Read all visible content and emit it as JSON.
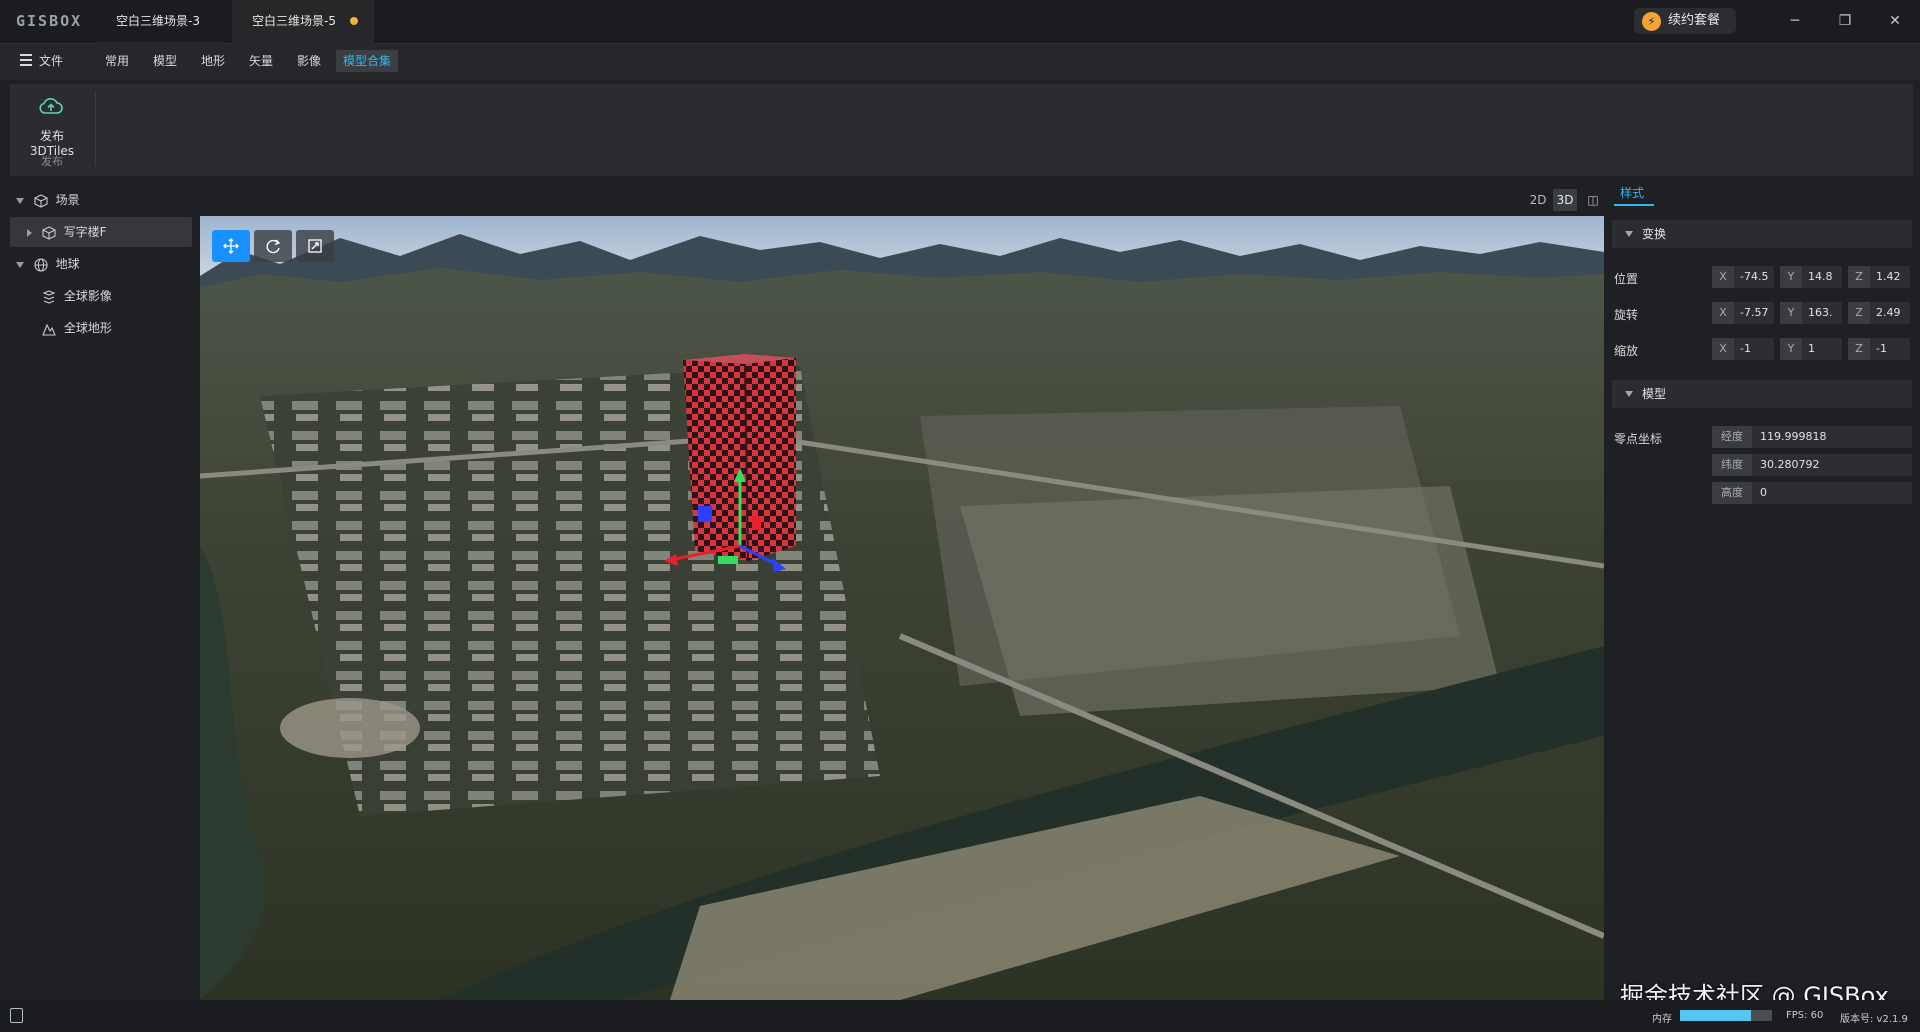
{
  "app": {
    "logo": "GISBOX"
  },
  "tabs": [
    {
      "label": "空白三维场景-3"
    },
    {
      "label": "空白三维场景-5",
      "unsaved": true
    }
  ],
  "renew_button": {
    "label": "续约套餐",
    "icon": "lightning-icon"
  },
  "window_controls": {
    "minimize": "─",
    "restore": "❐",
    "close": "✕"
  },
  "menu": {
    "file": "文件",
    "items": [
      "常用",
      "模型",
      "地形",
      "矢量",
      "影像",
      "模型合集"
    ],
    "active": "模型合集"
  },
  "ribbon": {
    "publish_label": "发布3DTiles",
    "group_label": "发布",
    "icon": "cloud-upload-icon"
  },
  "tree": {
    "scene": "场景",
    "scene_child": "写字楼F",
    "earth": "地球",
    "imagery": "全球影像",
    "terrain": "全球地形"
  },
  "view_modes": {
    "two_d": "2D",
    "three_d": "3D",
    "split": "◫",
    "active": "3D"
  },
  "viewport_tools": [
    "move-tool-icon",
    "rotate-tool-icon",
    "scale-tool-icon"
  ],
  "right_panel": {
    "tab": "样式",
    "transform": {
      "title": "变换",
      "position_label": "位置",
      "rotation_label": "旋转",
      "scale_label": "缩放",
      "position": {
        "x": "-74.5",
        "y": "14.8",
        "z": "1.42"
      },
      "rotation": {
        "x": "-7.57",
        "y": "163.",
        "z": "2.49"
      },
      "scale": {
        "x": "-1",
        "y": "1",
        "z": "-1"
      }
    },
    "model": {
      "title": "模型",
      "origin_label": "零点坐标",
      "lon_label": "经度",
      "lon": "119.999818",
      "lat_label": "纬度",
      "lat": "30.280792",
      "height_label": "高度",
      "height": "0"
    }
  },
  "watermark": "掘金技术社区 @ GISBox",
  "status": {
    "memory_label": "内存",
    "memory_fraction": 0.77,
    "fps": "FPS: 60",
    "version": "版本号: v2.1.9"
  },
  "colors": {
    "accent": "#2fb7ee",
    "active_tool": "#1890ff",
    "unsaved_dot": "#f0b43a",
    "building_red": "#d9343f"
  }
}
